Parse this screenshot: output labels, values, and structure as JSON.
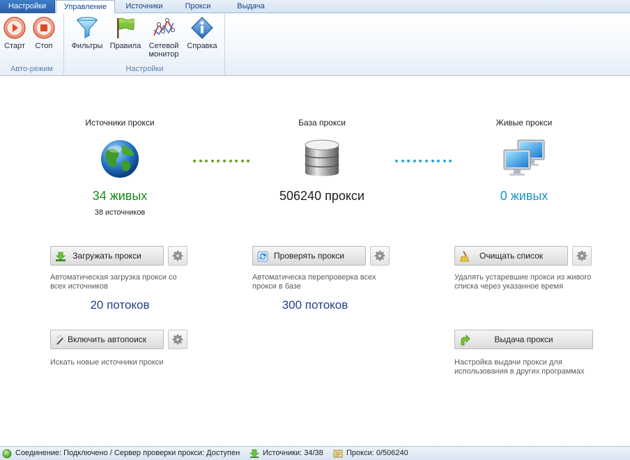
{
  "tabs": [
    {
      "label": "Настройки",
      "active": false,
      "app_menu": true
    },
    {
      "label": "Управление",
      "active": true
    },
    {
      "label": "Источники",
      "active": false
    },
    {
      "label": "Прокси",
      "active": false
    },
    {
      "label": "Выдача",
      "active": false
    }
  ],
  "ribbon": {
    "auto_group": {
      "label": "Авто-режим",
      "start_label": "Старт",
      "stop_label": "Стоп"
    },
    "settings_group": {
      "label": "Настройки",
      "filters_label": "Фильтры",
      "rules_label": "Правила",
      "network_label_1": "Сетевой",
      "network_label_2": "монитор",
      "help_label": "Справка"
    }
  },
  "main": {
    "sources": {
      "title": "Источники прокси",
      "live": "34 живых",
      "count": "38 источников",
      "live_color": "#1a8a1a"
    },
    "database": {
      "title": "База прокси",
      "count": "506240 прокси"
    },
    "alive": {
      "title": "Живые прокси",
      "live": "0 живых",
      "live_color": "#1a97c8"
    },
    "load": {
      "button": "Загружать прокси",
      "desc_1": "Автоматическая загрузка прокси со",
      "desc_2": "всех источников",
      "threads": "20 потоков"
    },
    "check": {
      "button": "Проверять прокси",
      "desc_1": "Автоматическа перепроверка всех",
      "desc_2": "прокси в базе",
      "threads": "300 потоков"
    },
    "clear": {
      "button": "Очищать список",
      "desc_1": "Удалять устаревшие прокси из живого",
      "desc_2": "списка через указанное время"
    },
    "autosearch": {
      "button": "Включить автопоиск",
      "desc": "Искать новые источники прокси"
    },
    "output": {
      "button": "Выдача прокси",
      "desc_1": "Настройка выдачи прокси для",
      "desc_2": "использования в других программах"
    }
  },
  "statusbar": {
    "connection": "Соединение: Подключено / Сервер проверки прокси: Доступен",
    "sources": "Источники: 34/38",
    "proxies": "Прокси: 0/506240"
  },
  "colors": {
    "accent": "#15428b",
    "green_dots": "#6aa01e",
    "blue_dots": "#2aa4dc",
    "threads": "#1f3f8f"
  }
}
